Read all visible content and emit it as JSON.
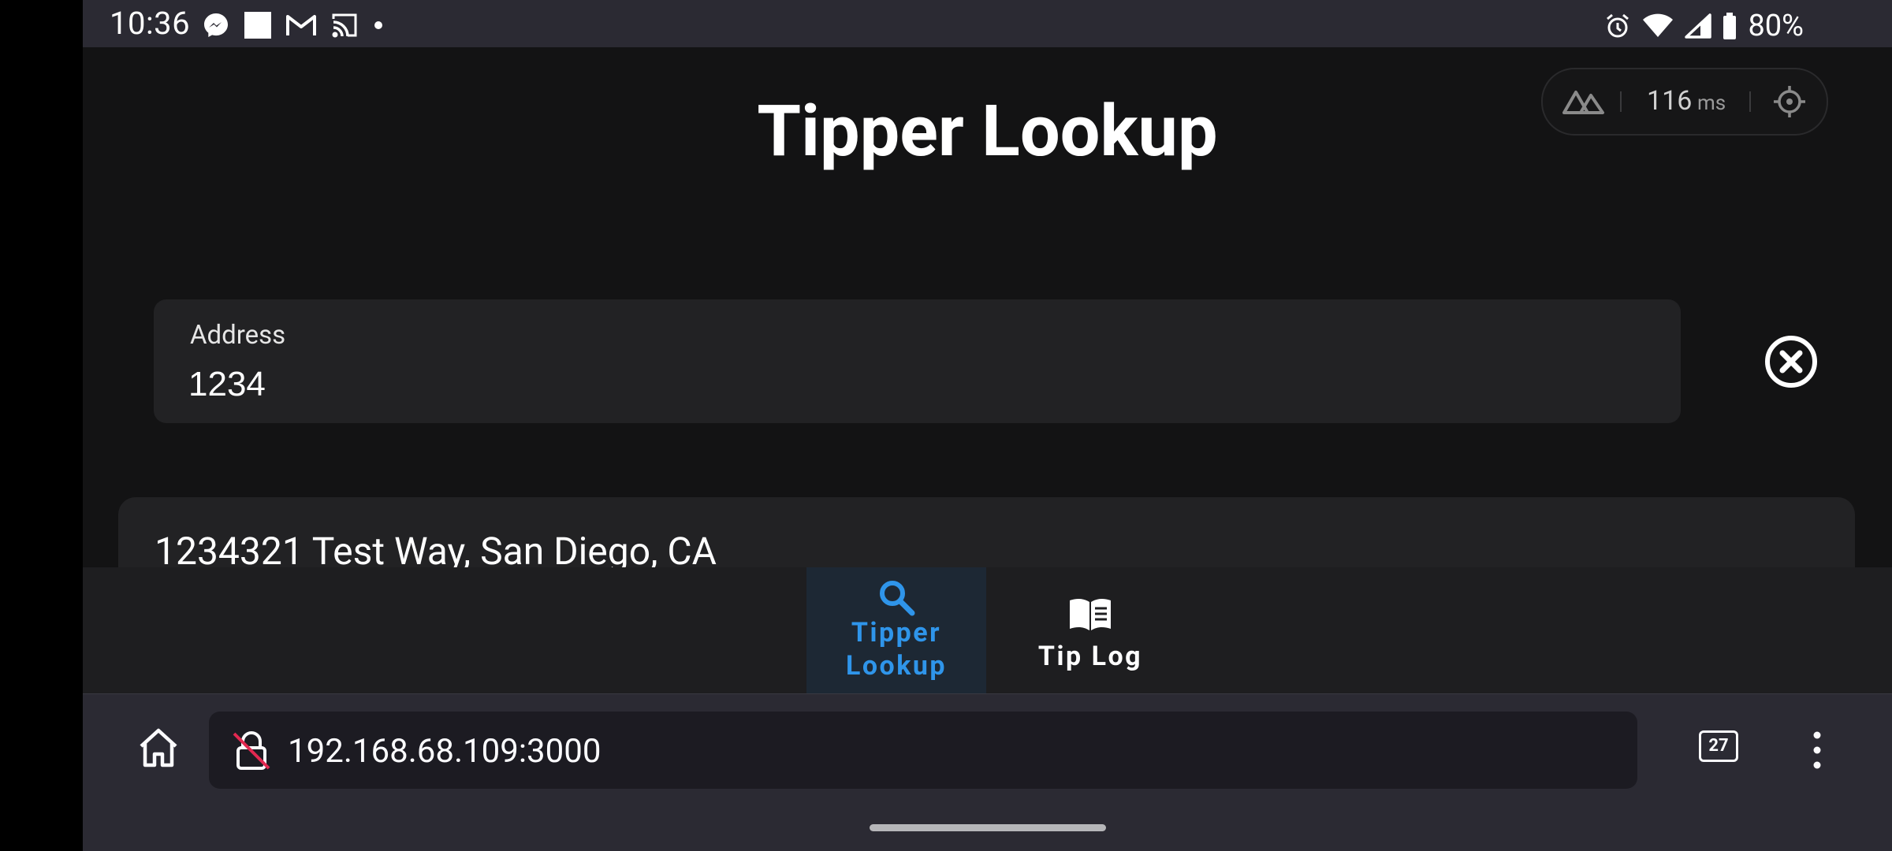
{
  "status_bar": {
    "time": "10:36",
    "battery": "80%",
    "left_icons": [
      "messenger-icon",
      "square-notification-icon",
      "gmail-icon",
      "cast-icon",
      "dot-icon"
    ],
    "right_icons": [
      "alarm-icon",
      "wifi-icon",
      "signal-icon",
      "battery-icon"
    ]
  },
  "page": {
    "title": "Tipper Lookup",
    "perf_widget": {
      "ms_value": "116",
      "ms_unit": "ms"
    },
    "address_field": {
      "label": "Address",
      "value": "1234"
    },
    "results": [
      {
        "text": "1234321 Test Way, San Diego, CA"
      }
    ]
  },
  "bottom_nav": {
    "items": [
      {
        "label": "Tipper\nLookup",
        "icon": "search-icon",
        "active": true
      },
      {
        "label": "Tip Log",
        "icon": "book-icon",
        "active": false
      }
    ]
  },
  "browser": {
    "url": "192.168.68.109:3000",
    "tab_count": "27"
  },
  "colors": {
    "accent": "#2f95ea",
    "background": "#131314",
    "surface": "#222224",
    "browser_bar": "#2b2a33"
  }
}
